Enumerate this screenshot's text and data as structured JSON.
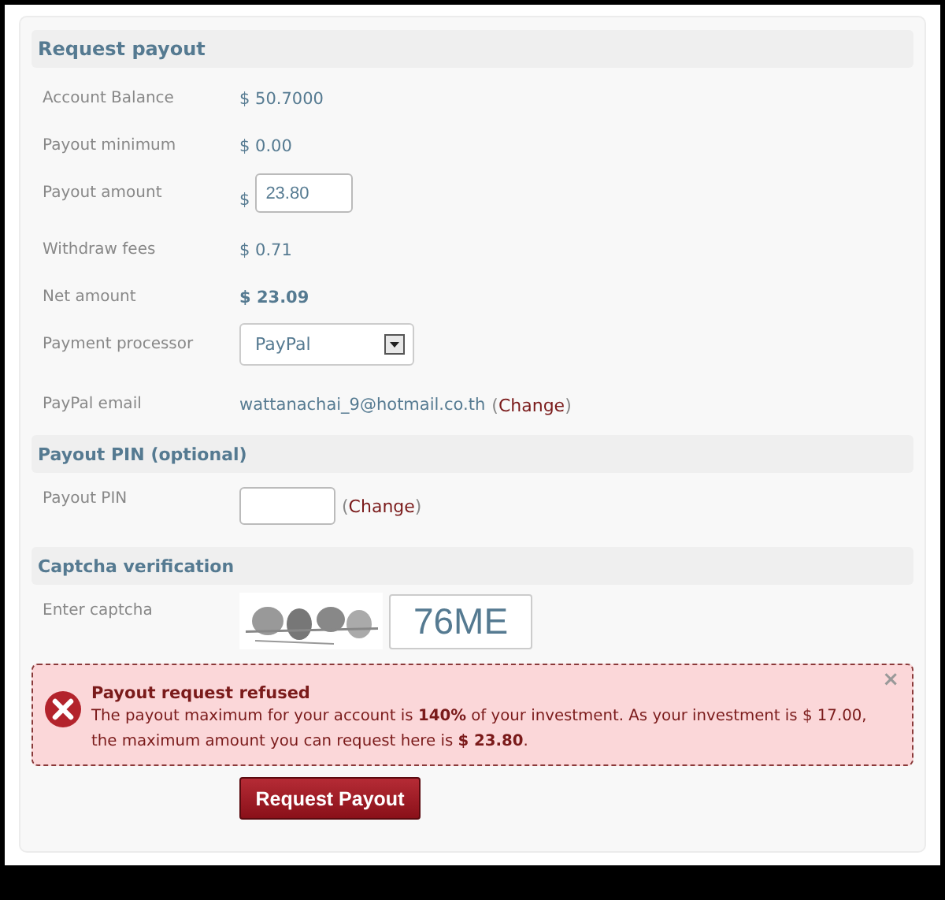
{
  "sections": [
    {
      "title": "Request payout",
      "rows": [
        {
          "kind": "text",
          "label": "Account Balance",
          "value": "$ 50.7000"
        },
        {
          "kind": "text",
          "label": "Payout minimum",
          "value": "$ 0.00"
        },
        {
          "kind": "amount",
          "label": "Payout amount",
          "prefix": "$",
          "value": "23.80"
        },
        {
          "kind": "text",
          "label": "Withdraw fees",
          "value": "$ 0.71"
        },
        {
          "kind": "strong",
          "label": "Net amount",
          "value": "$ 23.09"
        },
        {
          "kind": "select",
          "label": "Payment processor",
          "value": "PayPal"
        },
        {
          "kind": "email",
          "label": "PayPal email",
          "value": "wattanachai_9@hotmail.co.th",
          "open": "(",
          "link": "Change",
          "close": ")"
        }
      ]
    },
    {
      "title": "Payout PIN (optional)",
      "rows": [
        {
          "kind": "pin",
          "label": "Payout PIN",
          "open": "(",
          "link": "Change",
          "close": ")"
        }
      ]
    },
    {
      "title": "Captcha verification",
      "rows": [
        {
          "kind": "captcha",
          "label": "Enter captcha",
          "value": "76ME"
        }
      ]
    }
  ],
  "error": {
    "title": "Payout request refused",
    "message": "The payout maximum for your account is **140%** of your investment. As your investment is $ 17.00, the maximum amount you can request here is **$ 23.80**.",
    "close": "×"
  },
  "submit": "Request Payout"
}
